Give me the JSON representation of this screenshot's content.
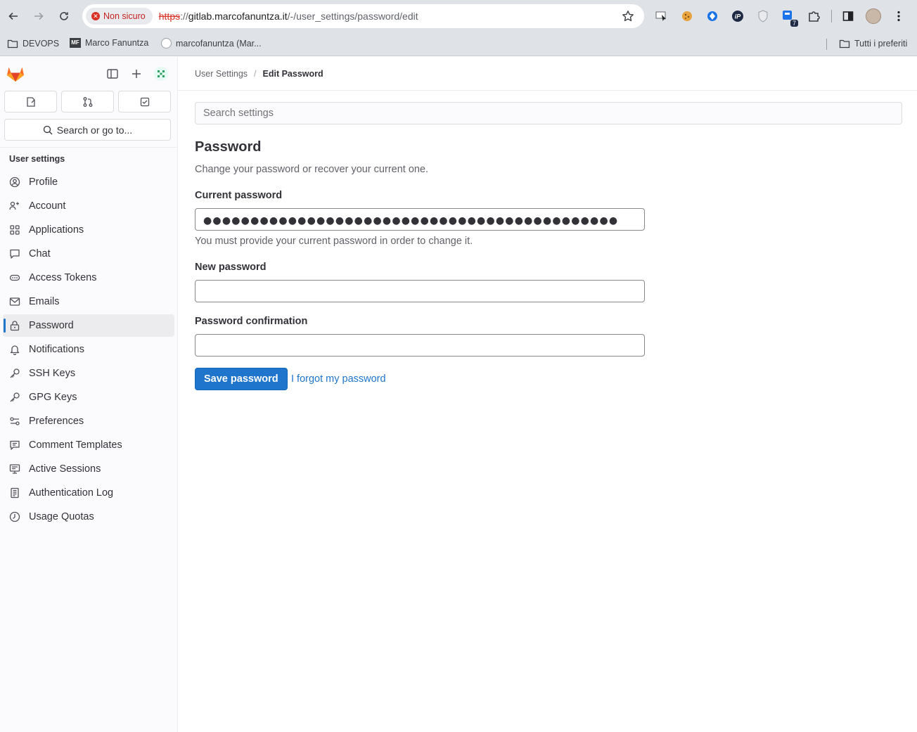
{
  "browser": {
    "security_label": "Non sicuro",
    "url_scheme": "https",
    "url_host": "gitlab.marcofanuntza.it",
    "url_path": "/-/user_settings/password/edit",
    "bookmarks": [
      {
        "label": "DEVOPS",
        "icon": "folder-icon"
      },
      {
        "label": "Marco Fanuntza",
        "icon": "mf-logo-icon"
      },
      {
        "label": "marcofanuntza (Mar...",
        "icon": "github-icon"
      }
    ],
    "all_bookmarks_label": "Tutti i preferiti",
    "extension_badge": "7"
  },
  "sidebar": {
    "search_label": "Search or go to...",
    "section_title": "User settings",
    "items": [
      {
        "label": "Profile",
        "icon": "profile-icon"
      },
      {
        "label": "Account",
        "icon": "account-icon"
      },
      {
        "label": "Applications",
        "icon": "applications-icon"
      },
      {
        "label": "Chat",
        "icon": "chat-icon"
      },
      {
        "label": "Access Tokens",
        "icon": "token-icon"
      },
      {
        "label": "Emails",
        "icon": "mail-icon"
      },
      {
        "label": "Password",
        "icon": "lock-icon",
        "active": true
      },
      {
        "label": "Notifications",
        "icon": "bell-icon"
      },
      {
        "label": "SSH Keys",
        "icon": "key-icon"
      },
      {
        "label": "GPG Keys",
        "icon": "key-icon"
      },
      {
        "label": "Preferences",
        "icon": "preferences-icon"
      },
      {
        "label": "Comment Templates",
        "icon": "comment-icon"
      },
      {
        "label": "Active Sessions",
        "icon": "monitor-icon"
      },
      {
        "label": "Authentication Log",
        "icon": "log-icon"
      },
      {
        "label": "Usage Quotas",
        "icon": "quota-icon"
      }
    ]
  },
  "breadcrumb": {
    "parent": "User Settings",
    "current": "Edit Password"
  },
  "main": {
    "search_placeholder": "Search settings",
    "title": "Password",
    "description": "Change your password or recover your current one.",
    "current_password_label": "Current password",
    "current_password_masked": "●●●●●●●●●●●●●●●●●●●●●●●●●●●●●●●●●●●●●●●●●●●●",
    "current_password_help": "You must provide your current password in order to change it.",
    "new_password_label": "New password",
    "confirm_password_label": "Password confirmation",
    "save_button": "Save password",
    "forgot_link": "I forgot my password"
  },
  "colors": {
    "primary": "#1f75cb",
    "danger": "#d93025",
    "gitlab_orange": "#fc6d26"
  }
}
